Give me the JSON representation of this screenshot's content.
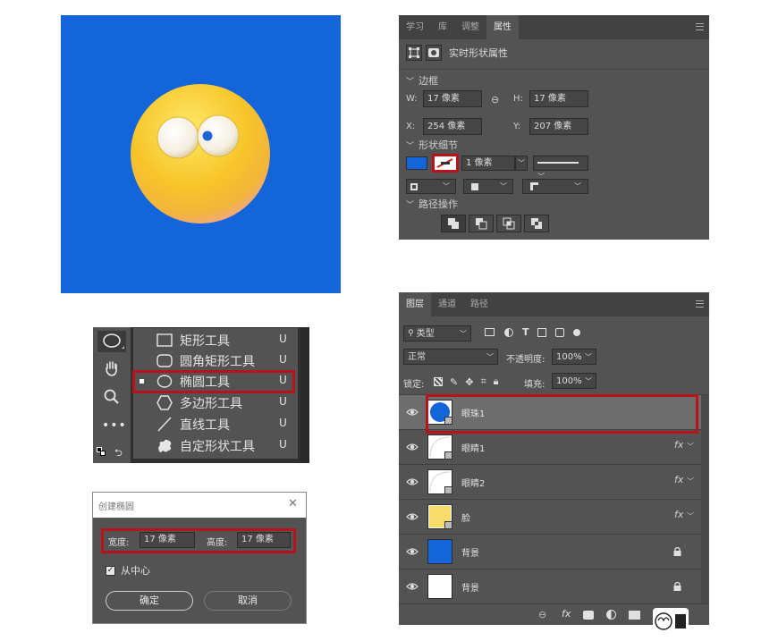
{
  "colors": {
    "canvas_blue": "#1465d9",
    "face_yellow": "#f6c21d",
    "highlight_red": "#b8131a",
    "ps_panel": "#535353",
    "ps_dark": "#424242"
  },
  "properties_panel": {
    "tabs": [
      "学习",
      "库",
      "调整",
      "属性"
    ],
    "active_tab": "属性",
    "header_label": "实时形状属性",
    "section_bounds": "边框",
    "w_label": "W:",
    "w_value": "17 像素",
    "h_label": "H:",
    "h_value": "17 像素",
    "x_label": "X:",
    "x_value": "254 像素",
    "y_label": "Y:",
    "y_value": "207 像素",
    "section_shape": "形状细节",
    "stroke_width": "1 像素",
    "section_path": "路径操作"
  },
  "tools_flyout": {
    "items": [
      {
        "label": "矩形工具",
        "key": "U",
        "icon": "rectangle-icon"
      },
      {
        "label": "圆角矩形工具",
        "key": "U",
        "icon": "rounded-rectangle-icon"
      },
      {
        "label": "椭圆工具",
        "key": "U",
        "icon": "ellipse-icon"
      },
      {
        "label": "多边形工具",
        "key": "U",
        "icon": "polygon-icon"
      },
      {
        "label": "直线工具",
        "key": "U",
        "icon": "line-icon"
      },
      {
        "label": "自定形状工具",
        "key": "U",
        "icon": "custom-shape-icon"
      }
    ],
    "selected_index": 2
  },
  "create_ellipse_dialog": {
    "title": "创建椭圆",
    "width_label": "宽度:",
    "width_value": "17 像素",
    "height_label": "高度:",
    "height_value": "17 像素",
    "from_center_label": "从中心",
    "from_center_checked": true,
    "ok_label": "确定",
    "cancel_label": "取消"
  },
  "layers_panel": {
    "tabs": [
      "图层",
      "通道",
      "路径"
    ],
    "active_tab": "图层",
    "filter_label": "类型",
    "blend_mode": "正常",
    "opacity_label": "不透明度:",
    "opacity_value": "100%",
    "lock_label": "锁定:",
    "fill_label": "填充:",
    "fill_value": "100%",
    "fx_label": "fx",
    "layers": [
      {
        "name": "眼珠1",
        "thumb": "blue-circle",
        "fx": false,
        "locked": false,
        "selected": true
      },
      {
        "name": "眼睛1",
        "thumb": "white-shape",
        "fx": true,
        "locked": false,
        "selected": false
      },
      {
        "name": "眼睛2",
        "thumb": "white-shape",
        "fx": true,
        "locked": false,
        "selected": false
      },
      {
        "name": "脸",
        "thumb": "yellow-shape",
        "fx": true,
        "locked": false,
        "selected": false
      },
      {
        "name": "背景",
        "thumb": "blue-fill",
        "fx": false,
        "locked": true,
        "selected": false
      },
      {
        "name": "背景",
        "thumb": "white-fill",
        "fx": false,
        "locked": true,
        "selected": false
      }
    ]
  }
}
